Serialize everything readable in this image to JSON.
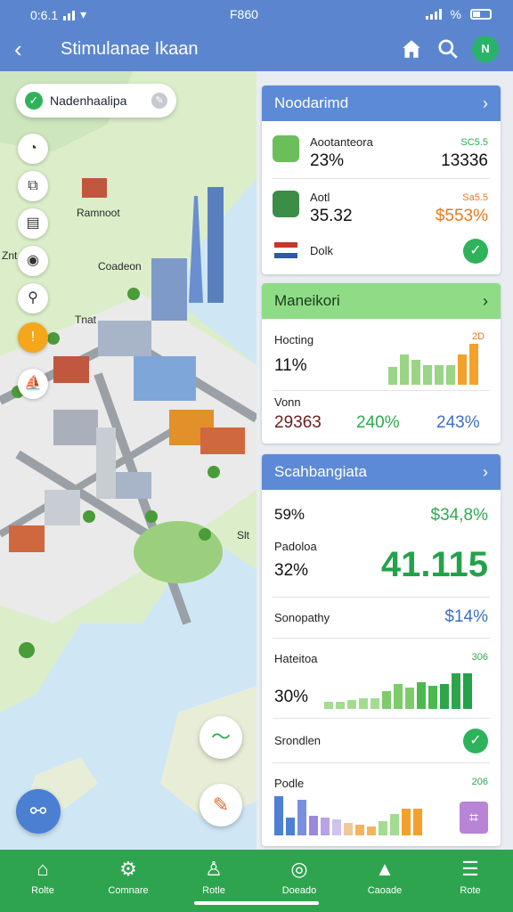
{
  "status": {
    "time": "0:6.1",
    "center_text": "F860",
    "battery_icon": "battery-icon"
  },
  "appbar": {
    "title": "Stimulanae Ikaan",
    "avatar_text": "N"
  },
  "map": {
    "chip_label": "Nadenhaalipa",
    "labels": {
      "building_a": "Ramnoot",
      "building_b": "Coadeon",
      "building_c": "Tnat",
      "edge_left": "Znt",
      "edge_right": "Slt"
    }
  },
  "card1": {
    "title": "Noodarimd",
    "rows": [
      {
        "name": "Aootanteora",
        "value": "23%",
        "tag": "SC5.5",
        "right": "13336",
        "tag_color": "green"
      },
      {
        "name": "Aotl",
        "value": "35.32",
        "tag": "Sa5.5",
        "right": "$553%",
        "tag_color": "orange"
      }
    ],
    "footer": "Dolk"
  },
  "card2": {
    "title": "Maneikori",
    "metric1_label": "Hocting",
    "metric1_value": "11%",
    "metric1_tag": "2D",
    "metric2_label": "Vonn",
    "metric2_value": "29363",
    "metric2_pct1": "240%",
    "metric2_pct2": "243%"
  },
  "card3": {
    "title": "Scahbangiata",
    "r1_value": "59%",
    "r1_right": "$34,8%",
    "r2_label": "Padoloa",
    "r2_value": "32%",
    "r2_big": "41.115",
    "r3_label": "Sonopathy",
    "r3_right": "$14%",
    "r4_label": "Hateitoa",
    "r4_tag": "306",
    "r4_value": "30%",
    "r5_label": "Srondlen",
    "r6_label": "Podle",
    "r6_tag": "206"
  },
  "nav": [
    {
      "label": "Rolte",
      "icon": "home-icon"
    },
    {
      "label": "Comnare",
      "icon": "settings-gear-icon"
    },
    {
      "label": "Rotle",
      "icon": "person-icon"
    },
    {
      "label": "Doeado",
      "icon": "target-icon"
    },
    {
      "label": "Caoade",
      "icon": "mountain-icon"
    },
    {
      "label": "Rote",
      "icon": "menu-icon"
    }
  ]
}
